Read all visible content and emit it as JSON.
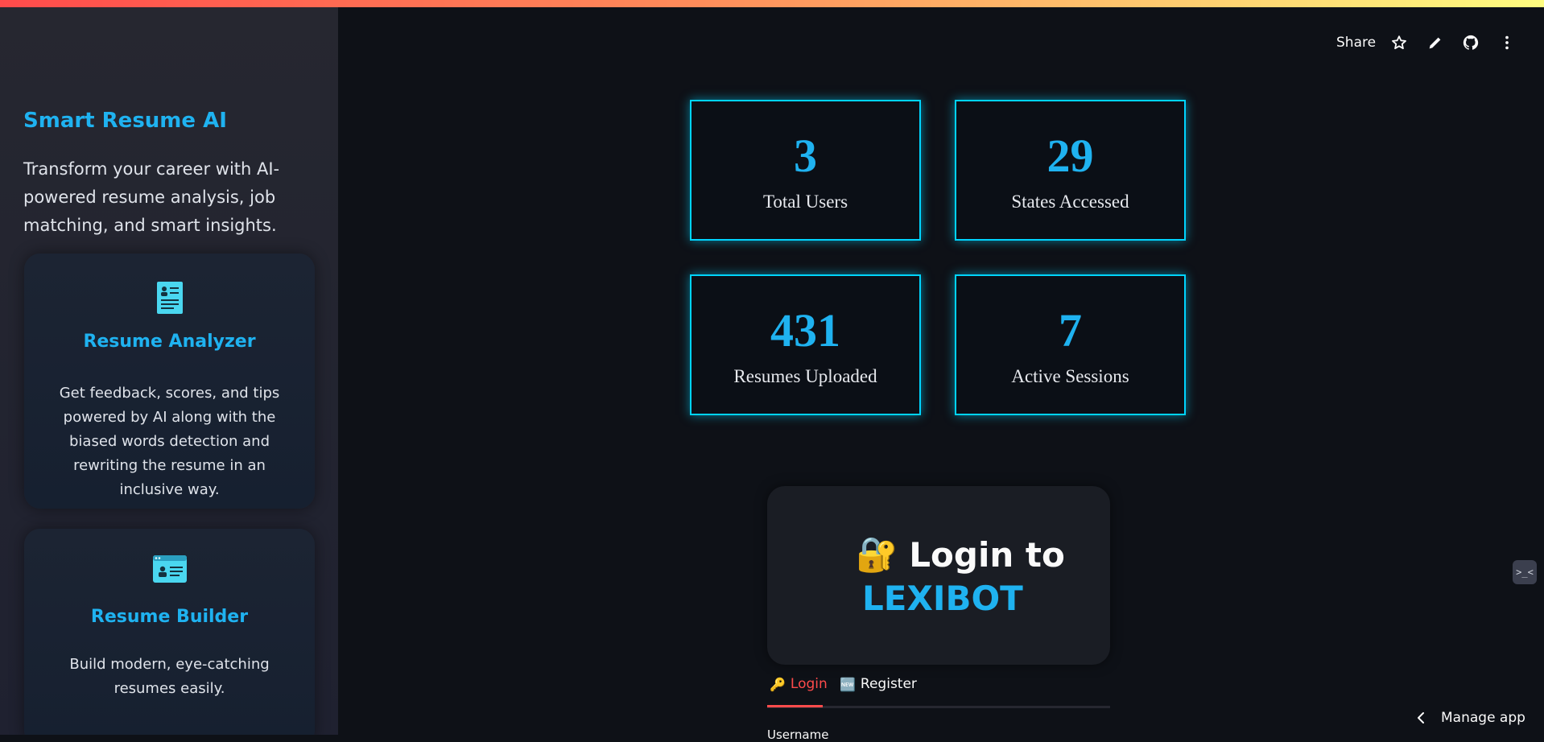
{
  "sidebar": {
    "title": "Smart Resume AI",
    "description": "Transform your career with AI-powered resume analysis, job matching, and smart insights.",
    "features": [
      {
        "icon": "resume-document-icon",
        "title": "Resume Analyzer",
        "description": "Get feedback, scores, and tips powered by AI along with the biased words detection and rewriting the resume in an inclusive way."
      },
      {
        "icon": "resume-builder-icon",
        "title": "Resume Builder",
        "description": "Build modern, eye-catching resumes easily."
      }
    ]
  },
  "header": {
    "share_label": "Share",
    "icons": [
      "star-icon",
      "edit-pencil-icon",
      "github-icon",
      "more-vertical-icon"
    ]
  },
  "stats": [
    {
      "value": "3",
      "label": "Total Users"
    },
    {
      "value": "29",
      "label": "States Accessed"
    },
    {
      "value": "431",
      "label": "Resumes Uploaded"
    },
    {
      "value": "7",
      "label": "Active Sessions"
    }
  ],
  "login": {
    "emoji": "🔐",
    "line1": "Login to",
    "line2": "LEXIBOT"
  },
  "tabs": [
    {
      "emoji": "🔑",
      "label": "Login",
      "active": true
    },
    {
      "emoji": "🆕",
      "label": "Register",
      "active": false
    }
  ],
  "form": {
    "username_label": "Username"
  },
  "side_badge": ">_<",
  "manage_app_label": "Manage app",
  "colors": {
    "accent": "#1fb2f0",
    "neon_border": "#00d4ff",
    "active_tab": "#ff4b4b",
    "background": "#0e1117"
  }
}
